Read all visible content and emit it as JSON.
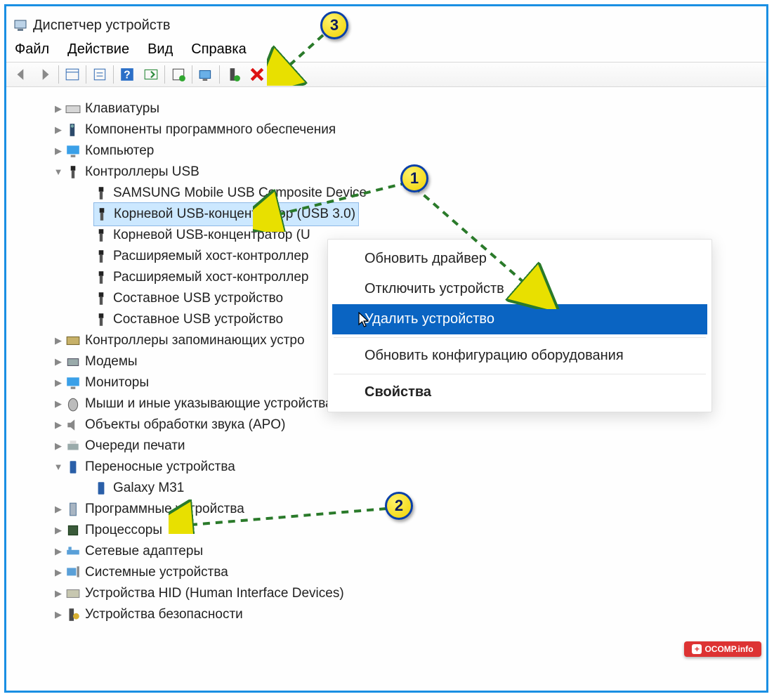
{
  "window": {
    "title": "Диспетчер устройств"
  },
  "menu": {
    "file": "Файл",
    "action": "Действие",
    "view": "Вид",
    "help": "Справка"
  },
  "tree": {
    "keyboards": "Клавиатуры",
    "software_components": "Компоненты программного обеспечения",
    "computer": "Компьютер",
    "usb_controllers": "Контроллеры USB",
    "usb_children": {
      "samsung": "SAMSUNG Mobile USB Composite Device",
      "root_hub_30": "Корневой USB-концентратор (USB 3.0)",
      "root_hub_u": "Корневой USB-концентратор (U",
      "ext_host_1": "Расширяемый хост-контроллер",
      "ext_host_2": "Расширяемый хост-контроллер",
      "composite_1": "Составное USB устройство",
      "composite_2": "Составное USB устройство"
    },
    "storage_controllers": "Контроллеры запоминающих устро",
    "modems": "Модемы",
    "monitors": "Мониторы",
    "mice": "Мыши и иные указывающие устройства",
    "apo": "Объекты обработки звука (APO)",
    "print_queues": "Очереди печати",
    "portable": "Переносные устройства",
    "portable_child": "Galaxy M31",
    "software_devices": "Программные устройства",
    "processors": "Процессоры",
    "network": "Сетевые адаптеры",
    "system_devices": "Системные устройства",
    "hid": "Устройства HID (Human Interface Devices)",
    "security": "Устройства безопасности"
  },
  "context_menu": {
    "update_driver": "Обновить драйвер",
    "disable_device": "Отключить устройств",
    "uninstall_device": "Удалить устройство",
    "scan_hw": "Обновить конфигурацию оборудования",
    "properties": "Свойства"
  },
  "badges": {
    "n1": "1",
    "n2": "2",
    "n3": "3"
  },
  "watermark": "OCOMP.info"
}
